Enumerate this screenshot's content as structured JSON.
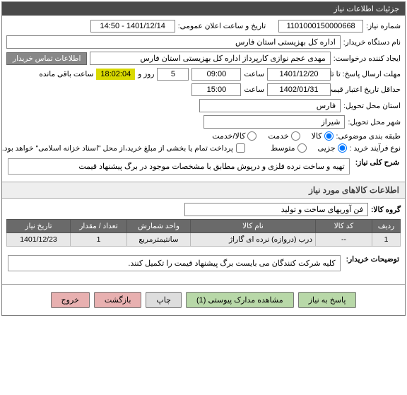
{
  "header": {
    "title": "جزئیات اطلاعات نیاز"
  },
  "fields": {
    "need_no_label": "شماره نیاز:",
    "need_no": "1101000150000668",
    "public_datetime_label": "تاریخ و ساعت اعلان عمومی:",
    "public_datetime": "1401/12/14 - 14:50",
    "buyer_label": "نام دستگاه خریدار:",
    "buyer": "اداره کل بهزیستی استان فارس",
    "requester_label": "ایجاد کننده درخواست:",
    "requester": "مهدی عجم نوازی کارپرداز اداره کل بهزیستی استان فارس",
    "contact_btn": "اطلاعات تماس خریدار",
    "deadline_label": "مهلت ارسال پاسخ: تا تاریخ:",
    "deadline_date": "1401/12/20",
    "time_label": "ساعت",
    "deadline_time": "09:00",
    "day_label": "روز و",
    "days": "5",
    "countdown": "18:02:04",
    "remaining": "ساعت باقی مانده",
    "validity_label": "حداقل تاریخ اعتبار قیمت: تا تاریخ:",
    "validity_date": "1402/01/31",
    "validity_time": "15:00",
    "province_label": "استان محل تحویل:",
    "province": "فارس",
    "city_label": "شهر محل تحویل:",
    "city": "شیراز",
    "category_label": "طبقه بندی موضوعی:",
    "cat_goods": "کالا",
    "cat_service": "خدمت",
    "cat_goods_service": "کالا/خدمت",
    "process_label": "نوع فرآیند خرید :",
    "proc_partial": "جزیی",
    "proc_medium": "متوسط",
    "payment_note": "پرداخت تمام یا بخشی از مبلغ خرید،از محل \"اسناد خزانه اسلامی\" خواهد بود.",
    "desc_label": "شرح کلی نیاز:",
    "desc": "تهیه و ساخت نرده فلزی و درپوش مطابق با مشخصات موجود در برگ پیشنهاد قیمت"
  },
  "items_section": {
    "title": "اطلاعات کالاهای مورد نیاز",
    "group_label": "گروه کالا:",
    "group": "فن آوریهای ساخت و تولید",
    "headers": {
      "row": "ردیف",
      "code": "کد کالا",
      "name": "نام کالا",
      "unit": "واحد شمارش",
      "qty": "تعداد / مقدار",
      "date": "تاریخ نیاز"
    },
    "rows": [
      {
        "row": "1",
        "code": "--",
        "name": "درب (دروازه) نرده ای گاراژ",
        "unit": "سانتیمترمربع",
        "qty": "1",
        "date": "1401/12/23"
      }
    ]
  },
  "buyer_notes": {
    "label": "توضیحات خریدار:",
    "text": "کلیه شرکت کنندگان می بایست برگ پیشنهاد قیمت را تکمیل کنند."
  },
  "footer": {
    "reply": "پاسخ به نیاز",
    "attachments": "مشاهده مدارک پیوستی (1)",
    "print": "چاپ",
    "back": "بازگشت",
    "exit": "خروج"
  }
}
